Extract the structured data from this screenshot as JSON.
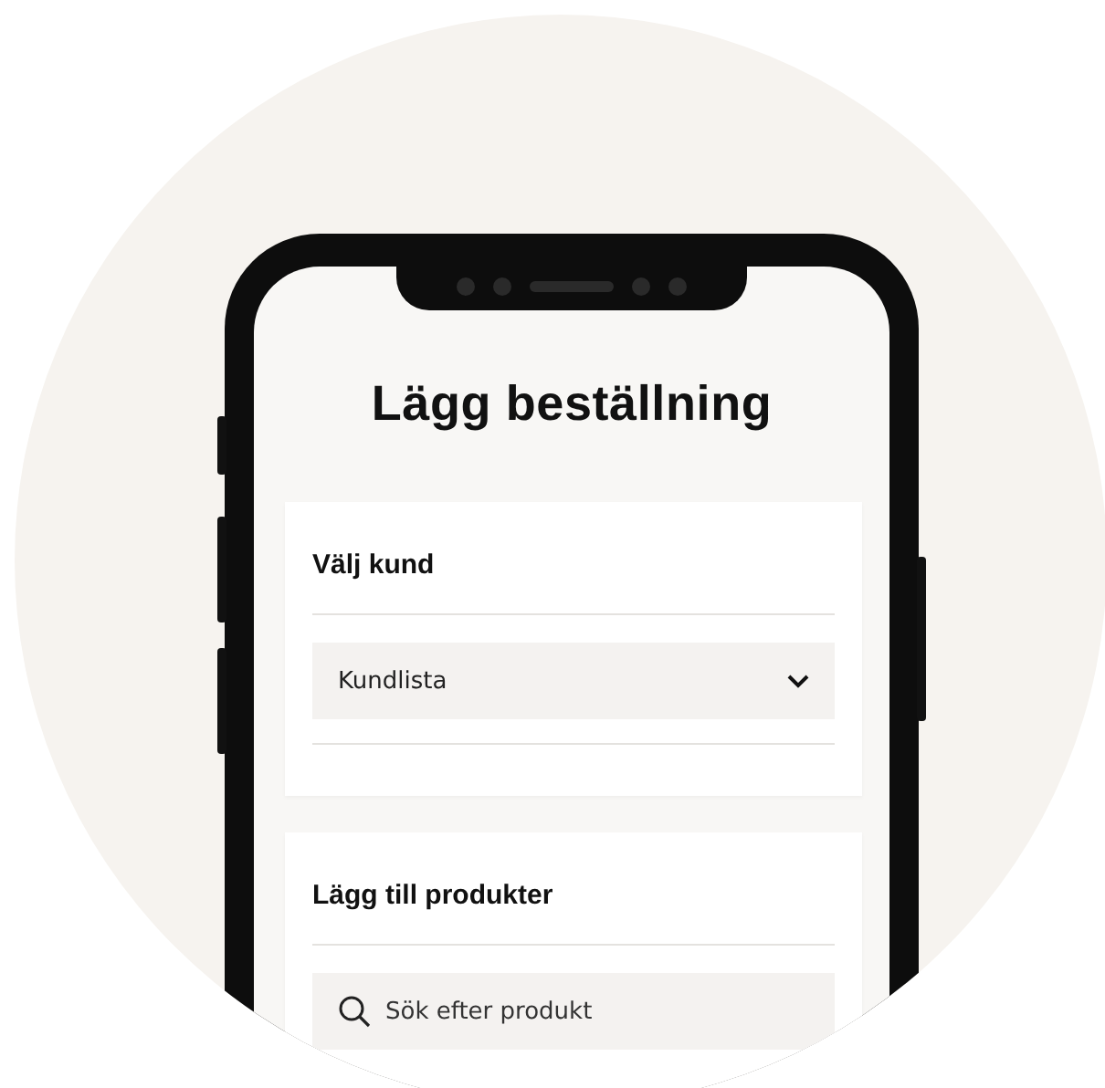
{
  "title": "Lägg beställning",
  "cards": [
    {
      "heading": "Välj kund",
      "field": {
        "kind": "select",
        "value": "Kundlista"
      }
    },
    {
      "heading": "Lägg till produkter",
      "field": {
        "kind": "search",
        "placeholder": "Sök efter produkt"
      }
    }
  ]
}
